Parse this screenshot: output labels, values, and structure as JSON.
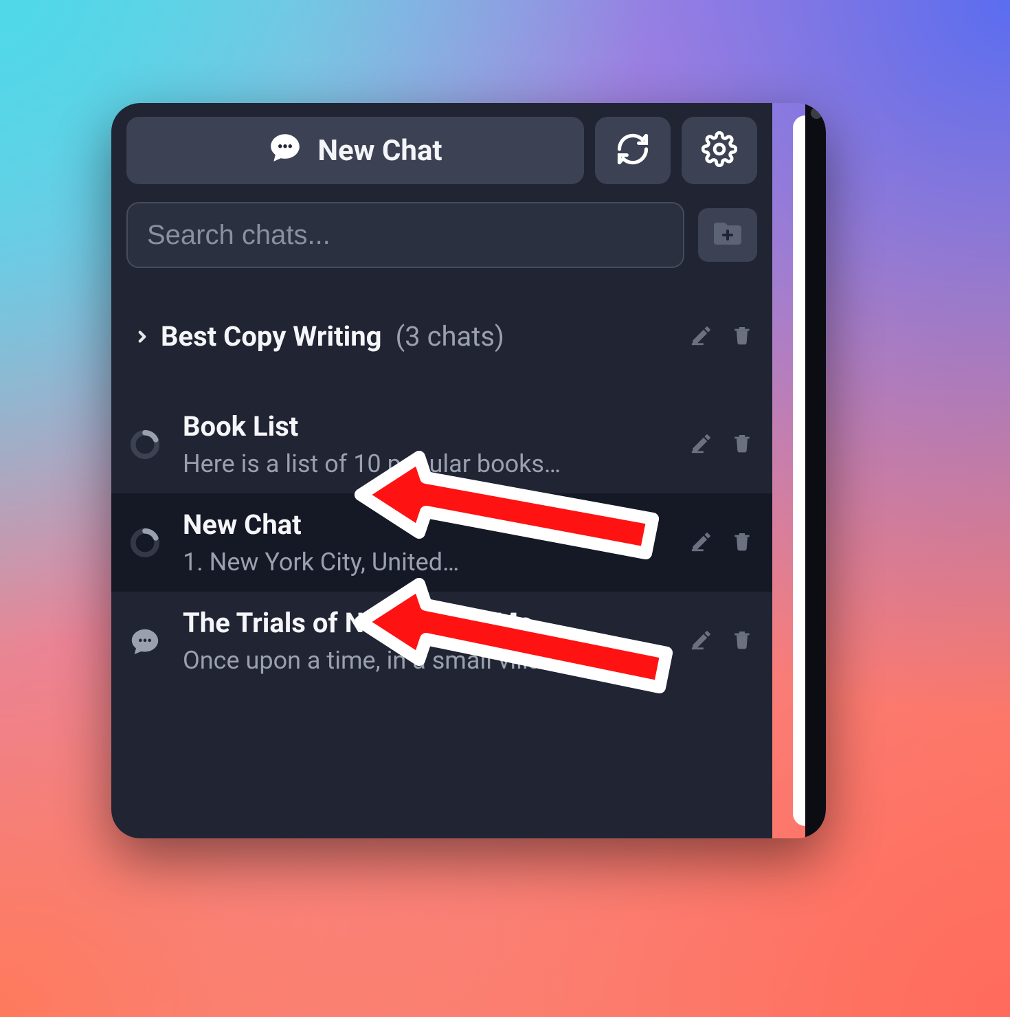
{
  "toolbar": {
    "new_chat_label": "New Chat"
  },
  "search": {
    "placeholder": "Search chats..."
  },
  "folder": {
    "name": "Best Copy Writing",
    "count_label": "(3 chats)"
  },
  "chats": [
    {
      "title": "Book List",
      "preview": "Here is a list of 10 popular books…",
      "loading": true,
      "selected": false
    },
    {
      "title": "New Chat",
      "preview": "1. New York City, United…",
      "loading": true,
      "selected": true
    },
    {
      "title": "The Trials of Nara's Wise Ma...",
      "preview": "Once upon a time, in a small villa...",
      "loading": false,
      "selected": false
    }
  ],
  "icons": {
    "chat": "chat-bubble-icon",
    "refresh": "refresh-icon",
    "gear": "gear-icon",
    "add_folder": "folder-plus-icon",
    "chevron": "chevron-right-icon",
    "edit": "pencil-icon",
    "trash": "trash-icon",
    "spinner": "spinner-icon"
  },
  "annotations": {
    "arrow1_target": "chats.0.title",
    "arrow2_target": "chats.1.title"
  }
}
